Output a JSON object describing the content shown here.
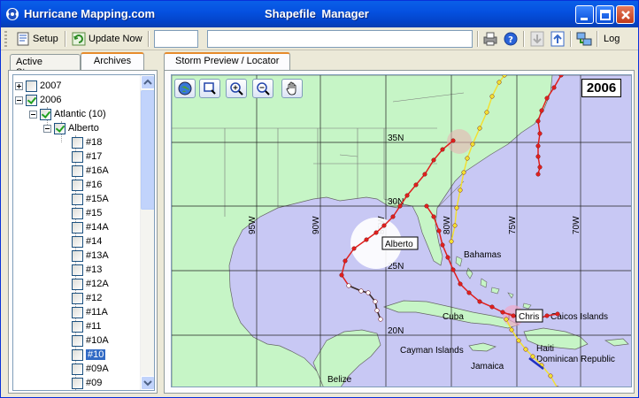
{
  "titlebar": {
    "app_title": "Hurricane Mapping.com",
    "window_title": "Shapefile Manager"
  },
  "toolbar": {
    "setup_label": "Setup",
    "update_label": "Update Now",
    "field1_value": "",
    "field2_value": "",
    "log_label": "Log"
  },
  "left_tabs": {
    "active_storms": "Active Storms",
    "archives": "Archives"
  },
  "tree": {
    "year_2007": "2007",
    "year_2006": "2006",
    "basin": "Atlantic (10)",
    "storm": "Alberto",
    "advisories": [
      "#18",
      "#17",
      "#16A",
      "#16",
      "#15A",
      "#15",
      "#14A",
      "#14",
      "#13A",
      "#13",
      "#12A",
      "#12",
      "#11A",
      "#11",
      "#10A",
      "#10",
      "#09A",
      "#09"
    ],
    "selected": "#10"
  },
  "right_tab": "Storm Preview / Locator",
  "map": {
    "year": "2006",
    "lat_labels": [
      "35N",
      "30N",
      "25N",
      "20N"
    ],
    "lon_labels": [
      "90W",
      "85W",
      "80W",
      "75W",
      "70W"
    ],
    "lon_label_95": "95W",
    "place_labels": {
      "bahamas": "Bahamas",
      "cuba": "Cuba",
      "cayman": "Cayman Islands",
      "jamaica": "Jamaica",
      "haiti": "Haiti",
      "dominican": "Dominican Republic",
      "caicos": "Caicos Islands",
      "belize": "Belize",
      "t": "T"
    },
    "storm_labels": {
      "alberto": "Alberto",
      "chris": "Chris"
    },
    "colors": {
      "water": "#c8c8f4",
      "land": "#c6f5c6",
      "track_red": "#e0201e",
      "track_yellow": "#f2e032"
    }
  }
}
